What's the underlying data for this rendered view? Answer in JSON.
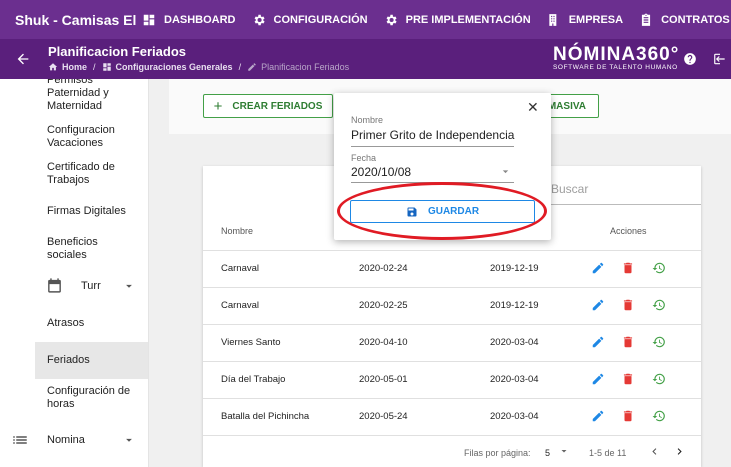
{
  "topbar": {
    "company": "Shuk - Camisas El",
    "nav": [
      {
        "label": "DASHBOARD",
        "icon": "dashboard-icon"
      },
      {
        "label": "CONFIGURACIÓN",
        "icon": "gear-icon"
      },
      {
        "label": "PRE IMPLEMENTACIÓN",
        "icon": "gear-icon"
      },
      {
        "label": "EMPRESA",
        "icon": "building-icon"
      },
      {
        "label": "CONTRATOS",
        "icon": "contract-icon"
      }
    ]
  },
  "subheader": {
    "title": "Planificacion Feriados",
    "breadcrumb": [
      "Home",
      "Configuraciones Generales",
      "Planificacion Feriados"
    ],
    "logo_main": "NÓMINA360°",
    "logo_sub": "SOFTWARE DE TALENTO HUMANO"
  },
  "sidebar": {
    "items": [
      "Permisos Paternidad y Maternidad",
      "Configuracion Vacaciones",
      "Certificado de Trabajos",
      "Firmas Digitales",
      "Beneficios sociales",
      "Turr",
      "Atrasos",
      "Feriados",
      "Configuración de horas",
      "Nomina"
    ],
    "active": "Feriados"
  },
  "actions": {
    "create_label": "CREAR FERIADOS",
    "masiva_label": "MASIVA"
  },
  "popup": {
    "name_label": "Nombre",
    "name_value": "Primer Grito de Independencia",
    "date_label": "Fecha",
    "date_value": "2020/10/08",
    "save_label": "GUARDAR"
  },
  "table": {
    "search_placeholder": "Buscar",
    "headers": {
      "name": "Nombre",
      "actions": "Acciones"
    },
    "rows": [
      {
        "name": "Carnaval",
        "date": "2020-02-24",
        "date2": "2019-12-19"
      },
      {
        "name": "Carnaval",
        "date": "2020-02-25",
        "date2": "2019-12-19"
      },
      {
        "name": "Viernes Santo",
        "date": "2020-04-10",
        "date2": "2020-03-04"
      },
      {
        "name": "Día del Trabajo",
        "date": "2020-05-01",
        "date2": "2020-03-04"
      },
      {
        "name": "Batalla del Pichincha",
        "date": "2020-05-24",
        "date2": "2020-03-04"
      }
    ],
    "footer": {
      "rows_label": "Filas por página:",
      "rows_value": "5",
      "range": "1-5 de 11"
    }
  },
  "colors": {
    "topbar": "#6b2f8f",
    "subheader": "#5a1f7c",
    "edit": "#1e88e5",
    "delete": "#e53935",
    "history": "#43a047",
    "highlight": "#e01b24"
  }
}
